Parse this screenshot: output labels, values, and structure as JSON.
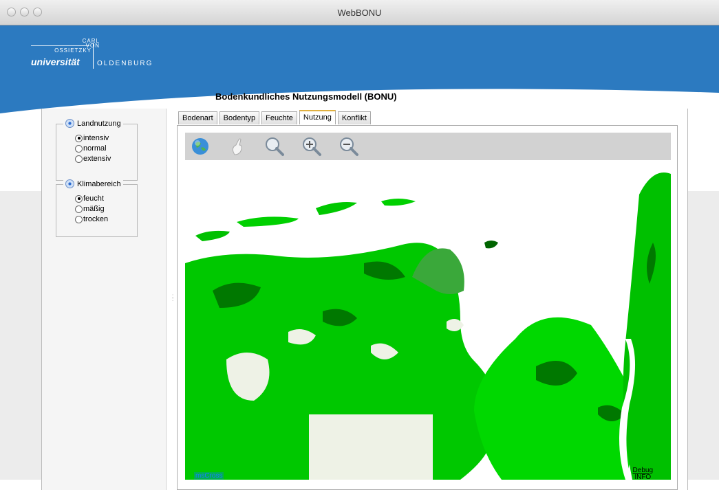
{
  "window": {
    "title": "WebBONU"
  },
  "logo": {
    "line1": "CARL",
    "line2": "VON",
    "line3": "OSSIETZKY",
    "uni": "universität",
    "city": "OLDENBURG"
  },
  "page": {
    "title": "Bodenkundliches Nutzungsmodell (BONU)"
  },
  "sidebar": {
    "landnutzung": {
      "label": "Landnutzung",
      "options": [
        "intensiv",
        "normal",
        "extensiv"
      ],
      "selected": "intensiv"
    },
    "klimabereich": {
      "label": "Klimabereich",
      "options": [
        "feucht",
        "mäßig",
        "trocken"
      ],
      "selected": "feucht"
    }
  },
  "tabs": [
    {
      "label": "Bodenart",
      "active": false
    },
    {
      "label": "Bodentyp",
      "active": false
    },
    {
      "label": "Feuchte",
      "active": false
    },
    {
      "label": "Nutzung",
      "active": true
    },
    {
      "label": "Konflikt",
      "active": false
    }
  ],
  "toolbar": {
    "tools": [
      "globe-icon",
      "pan-hand-icon",
      "zoom-box-icon",
      "zoom-in-icon",
      "zoom-out-icon"
    ]
  },
  "map": {
    "overlay_left": "msCross",
    "debug_line1": "Debug",
    "debug_line2": "INFO"
  },
  "colors": {
    "header_blue": "#2c7ac0",
    "land_bright": "#00e000",
    "land_mid": "#00b000",
    "land_dark": "#006400",
    "land_pale": "#eef2e6"
  }
}
